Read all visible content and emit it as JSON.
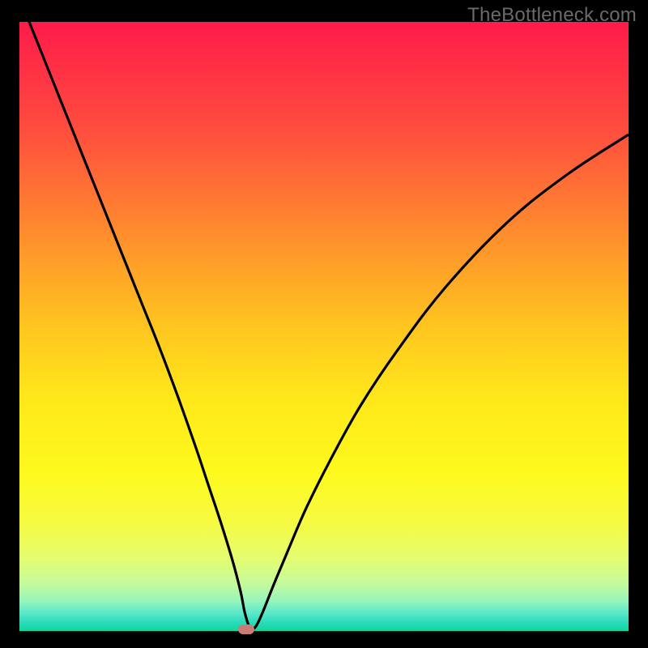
{
  "watermark": "TheBottleneck.com",
  "colors": {
    "curve_stroke": "#000000",
    "marker_fill": "#cc7b77"
  },
  "chart_data": {
    "type": "line",
    "title": "",
    "xlabel": "",
    "ylabel": "",
    "xlim": [
      0,
      100
    ],
    "ylim": [
      0,
      100
    ],
    "series": [
      {
        "name": "bottleneck-curve",
        "x": [
          0,
          2,
          5,
          8,
          11,
          14,
          17,
          20,
          23,
          26,
          29,
          31,
          33,
          35,
          36.3,
          37,
          37.8,
          38.7,
          39.9,
          41.7,
          44,
          47,
          51,
          56,
          62,
          70,
          80,
          90,
          100
        ],
        "y": [
          104,
          99,
          91.5,
          84,
          76.5,
          69,
          61.5,
          54,
          46.5,
          38.5,
          30,
          24,
          18,
          11.5,
          6.5,
          3,
          0.6,
          0.6,
          3,
          7.5,
          13,
          20,
          28,
          37,
          46,
          56.5,
          67,
          75,
          81.5
        ]
      }
    ],
    "marker": {
      "x": 37.3,
      "y": 0.2
    }
  }
}
